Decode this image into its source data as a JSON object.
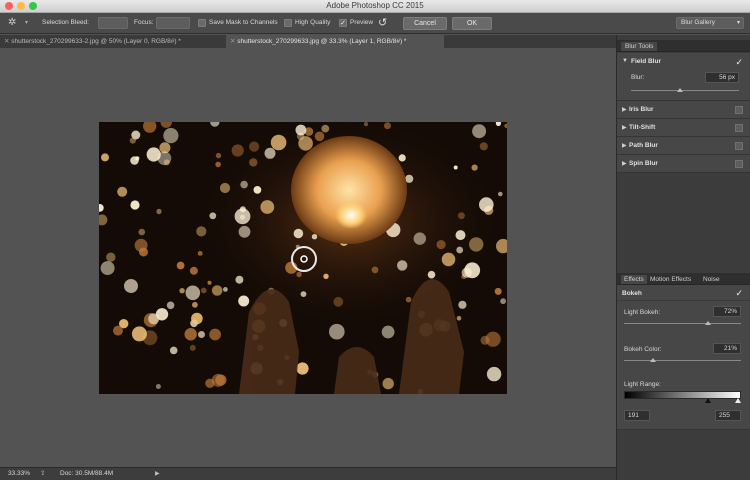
{
  "window": {
    "title": "Adobe Photoshop CC 2015"
  },
  "options_bar": {
    "selection_bleed_label": "Selection Bleed:",
    "focus_label": "Focus:",
    "save_mask_label": "Save Mask to Channels",
    "high_quality_label": "High Quality",
    "preview_label": "Preview",
    "preview_checked": true,
    "cancel_label": "Cancel",
    "ok_label": "OK",
    "workspace_value": "Blur Gallery"
  },
  "doc_tabs": [
    {
      "label": "shutterstock_270299633-2.jpg @ 50% (Layer 0, RGB/8#) *",
      "active": false
    },
    {
      "label": "shutterstock_270299633.jpg @ 33.3% (Layer 1, RGB/8#) *",
      "active": true
    }
  ],
  "status_bar": {
    "zoom": "33.33%",
    "doc_info": "Doc: 30.5M/88.4M"
  },
  "blur_tools": {
    "header": "Blur Tools",
    "items": [
      {
        "label": "Field Blur",
        "checked": true,
        "expanded": true
      },
      {
        "label": "Iris Blur",
        "checked": false,
        "expanded": false
      },
      {
        "label": "Tilt-Shift",
        "checked": false,
        "expanded": false
      },
      {
        "label": "Path Blur",
        "checked": false,
        "expanded": false
      },
      {
        "label": "Spin Blur",
        "checked": false,
        "expanded": false
      }
    ],
    "blur_label": "Blur:",
    "blur_value": "56 px"
  },
  "effects": {
    "tabs": [
      "Effects",
      "Motion Effects",
      "Noise"
    ],
    "bokeh_label": "Bokeh",
    "bokeh_checked": true,
    "light_bokeh_label": "Light Bokeh:",
    "light_bokeh_value": "72%",
    "bokeh_color_label": "Bokeh Color:",
    "bokeh_color_value": "21%",
    "light_range_label": "Light Range:",
    "light_range_low": "191",
    "light_range_high": "255"
  },
  "colors": {
    "accent": "#f5a623",
    "panel": "#3c3c3c",
    "workspace": "#535353"
  }
}
